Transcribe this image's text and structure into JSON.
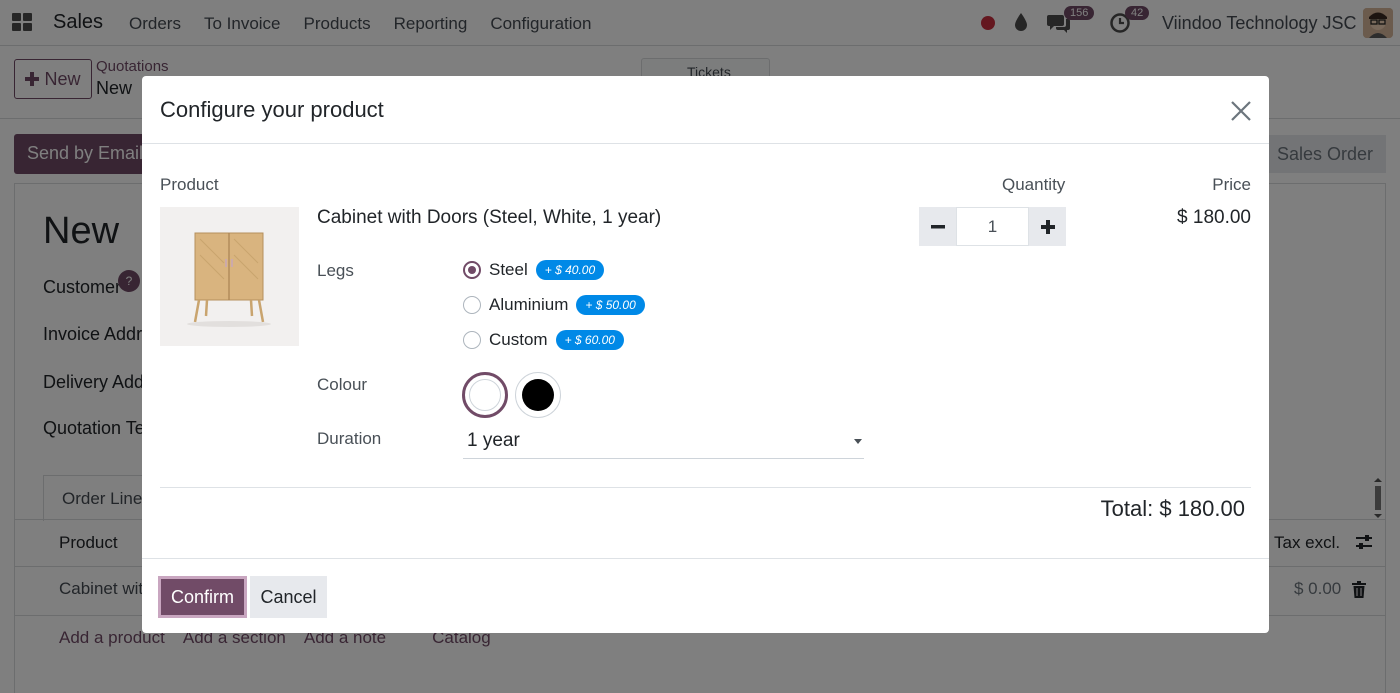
{
  "navbar": {
    "app_name": "Sales",
    "menu": [
      "Orders",
      "To Invoice",
      "Products",
      "Reporting",
      "Configuration"
    ],
    "chat_count": "156",
    "activity_count": "42",
    "company": "Viindoo Technology JSC"
  },
  "control_panel": {
    "new_label": "New",
    "breadcrumb_parent": "Quotations",
    "breadcrumb_current": "New",
    "tickets_label": "Tickets"
  },
  "statusbar": {
    "send_by_email": "Send by Email",
    "sales_order": "Sales Order"
  },
  "form": {
    "title": "New",
    "customer_label": "Customer",
    "help_mark": "?",
    "invoice_address_label": "Invoice Addre",
    "delivery_address_label": "Delivery Addr",
    "quotation_template_label": "Quotation Te",
    "tab_order_lines": "Order Line",
    "col_product": "Product",
    "col_tax_excl": "Tax excl.",
    "row_product": "Cabinet wit",
    "row_subtotal": "$ 0.00",
    "add_product": "Add a product",
    "add_section": "Add a section",
    "add_note": "Add a note",
    "catalog": "Catalog"
  },
  "modal": {
    "title": "Configure your product",
    "col_product": "Product",
    "col_quantity": "Quantity",
    "col_price": "Price",
    "product_name": "Cabinet with Doors (Steel, White, 1 year)",
    "quantity": "1",
    "price": "$ 180.00",
    "legs_label": "Legs",
    "legs_options": [
      {
        "label": "Steel",
        "extra": "+ $ 40.00",
        "checked": true
      },
      {
        "label": "Aluminium",
        "extra": "+ $ 50.00",
        "checked": false
      },
      {
        "label": "Custom",
        "extra": "+ $ 60.00",
        "checked": false
      }
    ],
    "colour_label": "Colour",
    "colour_options": [
      {
        "name": "white-swatch",
        "color": "#ffffff",
        "selected": true
      },
      {
        "name": "black-swatch",
        "color": "#000000",
        "selected": false
      }
    ],
    "duration_label": "Duration",
    "duration_value": "1 year",
    "total": "Total: $ 180.00",
    "confirm_label": "Confirm",
    "cancel_label": "Cancel"
  },
  "colors": {
    "brand": "#714b67",
    "extra_badge": "#0089e7",
    "overlay": "rgba(0,0,0,0.5)"
  }
}
